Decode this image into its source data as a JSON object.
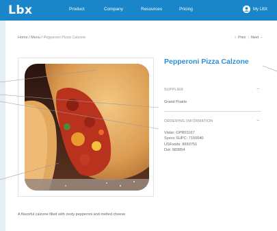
{
  "brand": {
    "logo_text": "Lbx",
    "accent": "#1a86c9"
  },
  "nav": {
    "items": [
      "Product",
      "Company",
      "Resources",
      "Pricing"
    ],
    "account_label": "My LBX",
    "account_icon": "user-circle-icon"
  },
  "breadcrumb": {
    "path": "Home / Menu / ",
    "current": "Pepperoni Pizza Calzone"
  },
  "pager": {
    "prev": "Prev",
    "separator": "|",
    "next": "Next"
  },
  "product": {
    "title": "Pepperoni Pizza Calzone",
    "description": "A flavorful calzone filled with zesty pepperoni and melted cheese"
  },
  "supplier": {
    "label": "SUPPLIER",
    "toggle": "−",
    "value": "Grand Prairie"
  },
  "ordering": {
    "label": "ORDERING INFORMATION",
    "toggle": "−",
    "items": [
      "Vistar: GPR01167",
      "Syeco SUPC: 7150040",
      "USFoods: 8650751",
      "Dot: 683854"
    ]
  }
}
